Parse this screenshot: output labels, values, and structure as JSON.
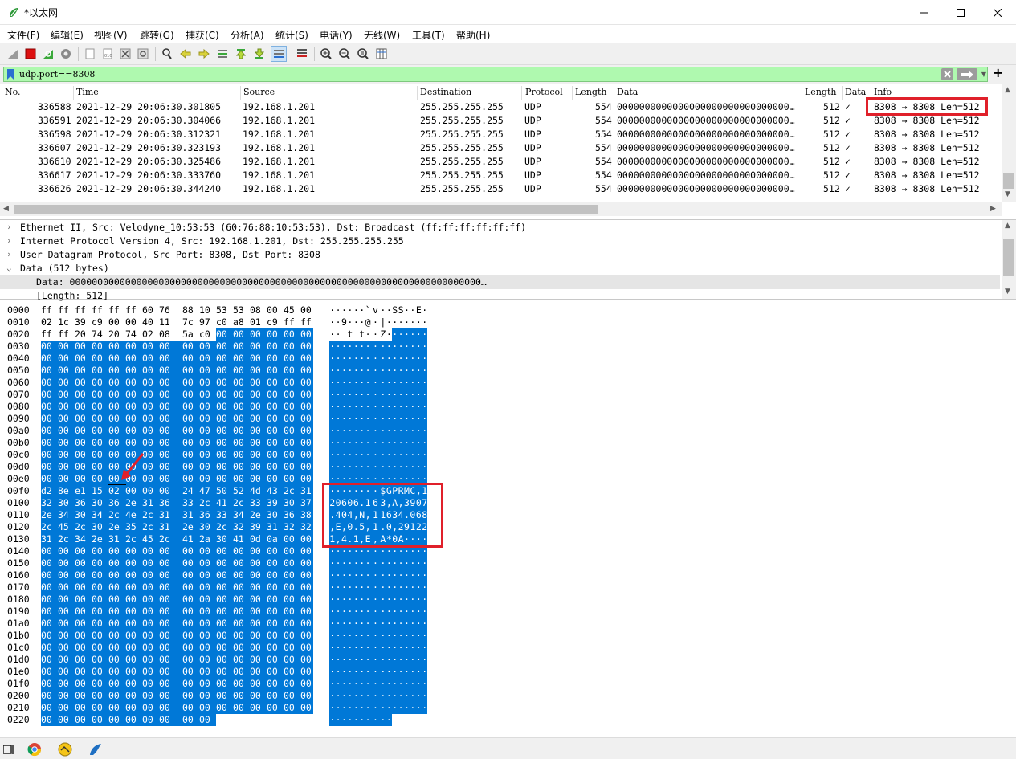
{
  "window": {
    "title": "*以太网"
  },
  "menu": [
    "文件(F)",
    "编辑(E)",
    "视图(V)",
    "跳转(G)",
    "捕获(C)",
    "分析(A)",
    "统计(S)",
    "电话(Y)",
    "无线(W)",
    "工具(T)",
    "帮助(H)"
  ],
  "filter": {
    "value": "udp.port==8308"
  },
  "packet_list": {
    "columns": [
      "No.",
      "Time",
      "Source",
      "Destination",
      "Protocol",
      "Length",
      "Data",
      "Length",
      "Data",
      "Info"
    ],
    "rows": [
      {
        "no": "336588",
        "time": "2021-12-29 20:06:30.301805",
        "src": "192.168.1.201",
        "dst": "255.255.255.255",
        "proto": "UDP",
        "len": "554",
        "data": "0000000000000000000000000000000…",
        "len2": "512",
        "check": "✓",
        "info": "8308 → 8308 Len=512"
      },
      {
        "no": "336591",
        "time": "2021-12-29 20:06:30.304066",
        "src": "192.168.1.201",
        "dst": "255.255.255.255",
        "proto": "UDP",
        "len": "554",
        "data": "0000000000000000000000000000000…",
        "len2": "512",
        "check": "✓",
        "info": "8308 → 8308 Len=512"
      },
      {
        "no": "336598",
        "time": "2021-12-29 20:06:30.312321",
        "src": "192.168.1.201",
        "dst": "255.255.255.255",
        "proto": "UDP",
        "len": "554",
        "data": "0000000000000000000000000000000…",
        "len2": "512",
        "check": "✓",
        "info": "8308 → 8308 Len=512"
      },
      {
        "no": "336607",
        "time": "2021-12-29 20:06:30.323193",
        "src": "192.168.1.201",
        "dst": "255.255.255.255",
        "proto": "UDP",
        "len": "554",
        "data": "0000000000000000000000000000000…",
        "len2": "512",
        "check": "✓",
        "info": "8308 → 8308 Len=512"
      },
      {
        "no": "336610",
        "time": "2021-12-29 20:06:30.325486",
        "src": "192.168.1.201",
        "dst": "255.255.255.255",
        "proto": "UDP",
        "len": "554",
        "data": "0000000000000000000000000000000…",
        "len2": "512",
        "check": "✓",
        "info": "8308 → 8308 Len=512"
      },
      {
        "no": "336617",
        "time": "2021-12-29 20:06:30.333760",
        "src": "192.168.1.201",
        "dst": "255.255.255.255",
        "proto": "UDP",
        "len": "554",
        "data": "0000000000000000000000000000000…",
        "len2": "512",
        "check": "✓",
        "info": "8308 → 8308 Len=512"
      },
      {
        "no": "336626",
        "time": "2021-12-29 20:06:30.344240",
        "src": "192.168.1.201",
        "dst": "255.255.255.255",
        "proto": "UDP",
        "len": "554",
        "data": "0000000000000000000000000000000…",
        "len2": "512",
        "check": "✓",
        "info": "8308 → 8308 Len=512"
      }
    ]
  },
  "details": [
    {
      "chevron": "›",
      "text": "Ethernet II, Src: Velodyne_10:53:53 (60:76:88:10:53:53), Dst: Broadcast (ff:ff:ff:ff:ff:ff)"
    },
    {
      "chevron": "›",
      "text": "Internet Protocol Version 4, Src: 192.168.1.201, Dst: 255.255.255.255"
    },
    {
      "chevron": "›",
      "text": "User Datagram Protocol, Src Port: 8308, Dst Port: 8308"
    },
    {
      "chevron": "⌄",
      "text": "Data (512 bytes)"
    },
    {
      "chevron": "",
      "text": "Data: 00000000000000000000000000000000000000000000000000000000000000000000000000…"
    },
    {
      "chevron": "",
      "text": "[Length: 512]"
    }
  ],
  "bytes": {
    "highlight_start": 42,
    "rows": [
      {
        "off": "0000",
        "hex": "ff ff ff ff ff ff 60 76 88 10 53 53 08 00 45 00",
        "ascii": "······`v··SS··E·"
      },
      {
        "off": "0010",
        "hex": "02 1c 39 c9 00 00 40 11 7c 97 c0 a8 01 c9 ff ff",
        "ascii": "··9···@·|·······"
      },
      {
        "off": "0020",
        "hex": "ff ff 20 74 20 74 02 08 5a c0 00 00 00 00 00 00",
        "ascii": "·· t t··Z·······"
      },
      {
        "off": "0030",
        "hex": "00 00 00 00 00 00 00 00 00 00 00 00 00 00 00 00",
        "ascii": "················"
      },
      {
        "off": "0040",
        "hex": "00 00 00 00 00 00 00 00 00 00 00 00 00 00 00 00",
        "ascii": "················"
      },
      {
        "off": "0050",
        "hex": "00 00 00 00 00 00 00 00 00 00 00 00 00 00 00 00",
        "ascii": "················"
      },
      {
        "off": "0060",
        "hex": "00 00 00 00 00 00 00 00 00 00 00 00 00 00 00 00",
        "ascii": "················"
      },
      {
        "off": "0070",
        "hex": "00 00 00 00 00 00 00 00 00 00 00 00 00 00 00 00",
        "ascii": "················"
      },
      {
        "off": "0080",
        "hex": "00 00 00 00 00 00 00 00 00 00 00 00 00 00 00 00",
        "ascii": "················"
      },
      {
        "off": "0090",
        "hex": "00 00 00 00 00 00 00 00 00 00 00 00 00 00 00 00",
        "ascii": "················"
      },
      {
        "off": "00a0",
        "hex": "00 00 00 00 00 00 00 00 00 00 00 00 00 00 00 00",
        "ascii": "················"
      },
      {
        "off": "00b0",
        "hex": "00 00 00 00 00 00 00 00 00 00 00 00 00 00 00 00",
        "ascii": "················"
      },
      {
        "off": "00c0",
        "hex": "00 00 00 00 00 00 00 00 00 00 00 00 00 00 00 00",
        "ascii": "················"
      },
      {
        "off": "00d0",
        "hex": "00 00 00 00 00 00 00 00 00 00 00 00 00 00 00 00",
        "ascii": "················"
      },
      {
        "off": "00e0",
        "hex": "00 00 00 00 00 00 00 00 00 00 00 00 00 00 00 00",
        "ascii": "················"
      },
      {
        "off": "00f0",
        "hex": "d2 8e e1 15 02 00 00 00 24 47 50 52 4d 43 2c 31",
        "ascii": "········$GPRMC,1"
      },
      {
        "off": "0100",
        "hex": "32 30 36 30 36 2e 31 36 33 2c 41 2c 33 39 30 37",
        "ascii": "20606.163,A,3907"
      },
      {
        "off": "0110",
        "hex": "2e 34 30 34 2c 4e 2c 31 31 36 33 34 2e 30 36 38",
        "ascii": ".404,N,11634.068"
      },
      {
        "off": "0120",
        "hex": "2c 45 2c 30 2e 35 2c 31 2e 30 2c 32 39 31 32 32",
        "ascii": ",E,0.5,1.0,29122"
      },
      {
        "off": "0130",
        "hex": "31 2c 34 2e 31 2c 45 2c 41 2a 30 41 0d 0a 00 00",
        "ascii": "1,4.1,E,A*0A····"
      },
      {
        "off": "0140",
        "hex": "00 00 00 00 00 00 00 00 00 00 00 00 00 00 00 00",
        "ascii": "················"
      },
      {
        "off": "0150",
        "hex": "00 00 00 00 00 00 00 00 00 00 00 00 00 00 00 00",
        "ascii": "················"
      },
      {
        "off": "0160",
        "hex": "00 00 00 00 00 00 00 00 00 00 00 00 00 00 00 00",
        "ascii": "················"
      },
      {
        "off": "0170",
        "hex": "00 00 00 00 00 00 00 00 00 00 00 00 00 00 00 00",
        "ascii": "················"
      },
      {
        "off": "0180",
        "hex": "00 00 00 00 00 00 00 00 00 00 00 00 00 00 00 00",
        "ascii": "················"
      },
      {
        "off": "0190",
        "hex": "00 00 00 00 00 00 00 00 00 00 00 00 00 00 00 00",
        "ascii": "················"
      },
      {
        "off": "01a0",
        "hex": "00 00 00 00 00 00 00 00 00 00 00 00 00 00 00 00",
        "ascii": "················"
      },
      {
        "off": "01b0",
        "hex": "00 00 00 00 00 00 00 00 00 00 00 00 00 00 00 00",
        "ascii": "················"
      },
      {
        "off": "01c0",
        "hex": "00 00 00 00 00 00 00 00 00 00 00 00 00 00 00 00",
        "ascii": "················"
      },
      {
        "off": "01d0",
        "hex": "00 00 00 00 00 00 00 00 00 00 00 00 00 00 00 00",
        "ascii": "················"
      },
      {
        "off": "01e0",
        "hex": "00 00 00 00 00 00 00 00 00 00 00 00 00 00 00 00",
        "ascii": "················"
      },
      {
        "off": "01f0",
        "hex": "00 00 00 00 00 00 00 00 00 00 00 00 00 00 00 00",
        "ascii": "················"
      },
      {
        "off": "0200",
        "hex": "00 00 00 00 00 00 00 00 00 00 00 00 00 00 00 00",
        "ascii": "················"
      },
      {
        "off": "0210",
        "hex": "00 00 00 00 00 00 00 00 00 00 00 00 00 00 00 00",
        "ascii": "················"
      },
      {
        "off": "0220",
        "hex": "00 00 00 00 00 00 00 00 00 00",
        "ascii": "··········"
      }
    ]
  },
  "colors": {
    "filter_bg": "#aff9af",
    "selection": "#0078d7",
    "annotation": "#e0202a"
  }
}
